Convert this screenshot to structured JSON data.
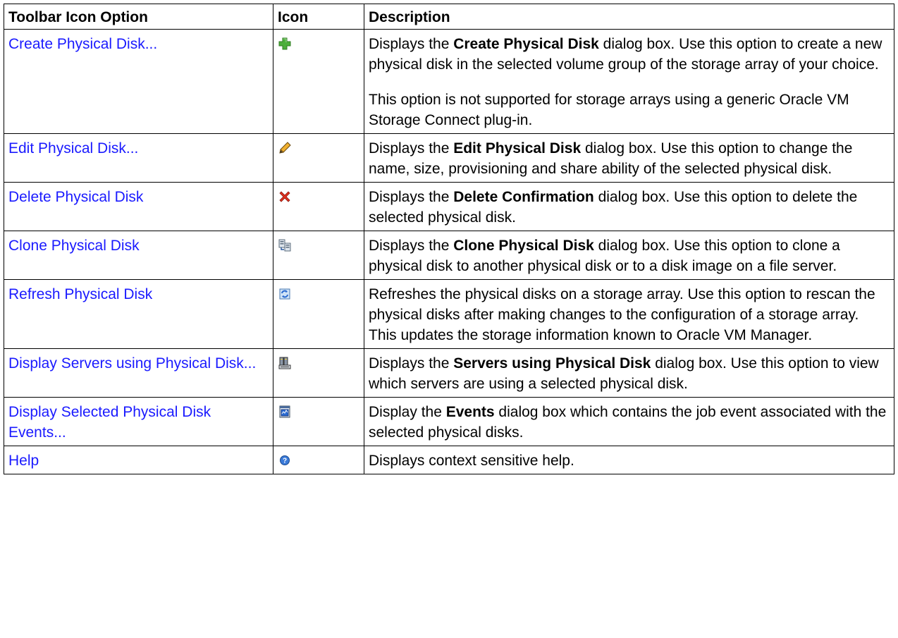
{
  "headers": {
    "option": "Toolbar Icon Option",
    "icon": "Icon",
    "description": "Description"
  },
  "rows": [
    {
      "option": "Create Physical Disk...",
      "icon": "add-icon",
      "paras": [
        {
          "pre": "Displays the ",
          "bold": "Create Physical Disk",
          "post": " dialog box. Use this option to create a new physical disk in the selected volume group of the storage array of your choice."
        },
        {
          "pre": "This option is not supported for storage arrays using a generic Oracle VM Storage Connect plug-in.",
          "bold": "",
          "post": ""
        }
      ]
    },
    {
      "option": "Edit Physical Disk...",
      "icon": "pencil-icon",
      "paras": [
        {
          "pre": "Displays the ",
          "bold": "Edit Physical Disk",
          "post": " dialog box. Use this option to change the name, size, provisioning and share ability of the selected physical disk."
        }
      ]
    },
    {
      "option": "Delete Physical Disk",
      "icon": "delete-icon",
      "paras": [
        {
          "pre": "Displays the ",
          "bold": "Delete Confirmation",
          "post": " dialog box. Use this option to delete the selected physical disk."
        }
      ]
    },
    {
      "option": "Clone Physical Disk",
      "icon": "clone-icon",
      "paras": [
        {
          "pre": "Displays the ",
          "bold": "Clone Physical Disk",
          "post": " dialog box. Use this option to clone a physical disk to another physical disk or to a disk image on a file server."
        }
      ]
    },
    {
      "option": "Refresh Physical Disk",
      "icon": "refresh-icon",
      "paras": [
        {
          "pre": "Refreshes the physical disks on a storage array. Use this option to rescan the physical disks after making changes to the configuration of a storage array. This updates the storage information known to Oracle VM Manager.",
          "bold": "",
          "post": ""
        }
      ]
    },
    {
      "option": "Display Servers using Physical Disk...",
      "icon": "servers-icon",
      "paras": [
        {
          "pre": "Displays the ",
          "bold": "Servers using Physical Disk",
          "post": " dialog box. Use this option to view which servers are using a selected physical disk."
        }
      ]
    },
    {
      "option": "Display Selected Physical Disk Events...",
      "icon": "events-icon",
      "paras": [
        {
          "pre": "Display the ",
          "bold": "Events",
          "post": " dialog box which contains the job event associated with the selected physical disks."
        }
      ]
    },
    {
      "option": "Help",
      "icon": "help-icon",
      "paras": [
        {
          "pre": "Displays context sensitive help.",
          "bold": "",
          "post": ""
        }
      ]
    }
  ]
}
